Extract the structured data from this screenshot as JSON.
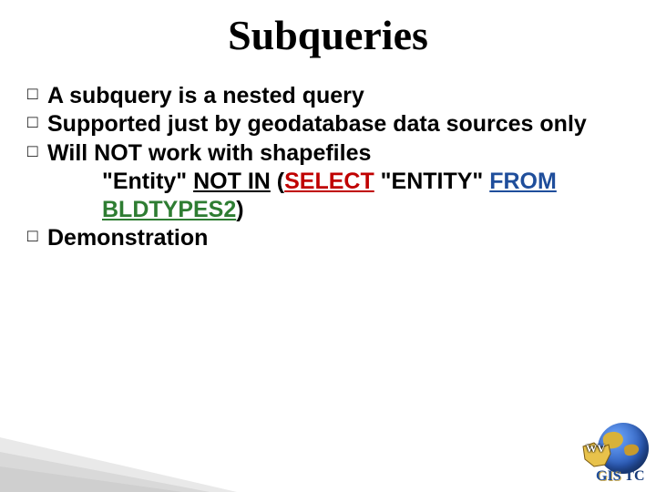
{
  "title": "Subqueries",
  "bullets": {
    "b1": "A subquery is a nested query",
    "b2": "Supported just by geodatabase data sources only",
    "b3": "Will NOT work with shapefiles",
    "b4": "Demonstration"
  },
  "code": {
    "entity": "\"Entity\" ",
    "notin": "NOT IN",
    "lp": " (",
    "select": "SELECT",
    "mid": " \"ENTITY\" ",
    "from": "FROM",
    "tbl": " BLDTYPES2",
    "rp": ")"
  },
  "logo": {
    "state": "WV",
    "gis": "GIS",
    "tc": " TC"
  }
}
